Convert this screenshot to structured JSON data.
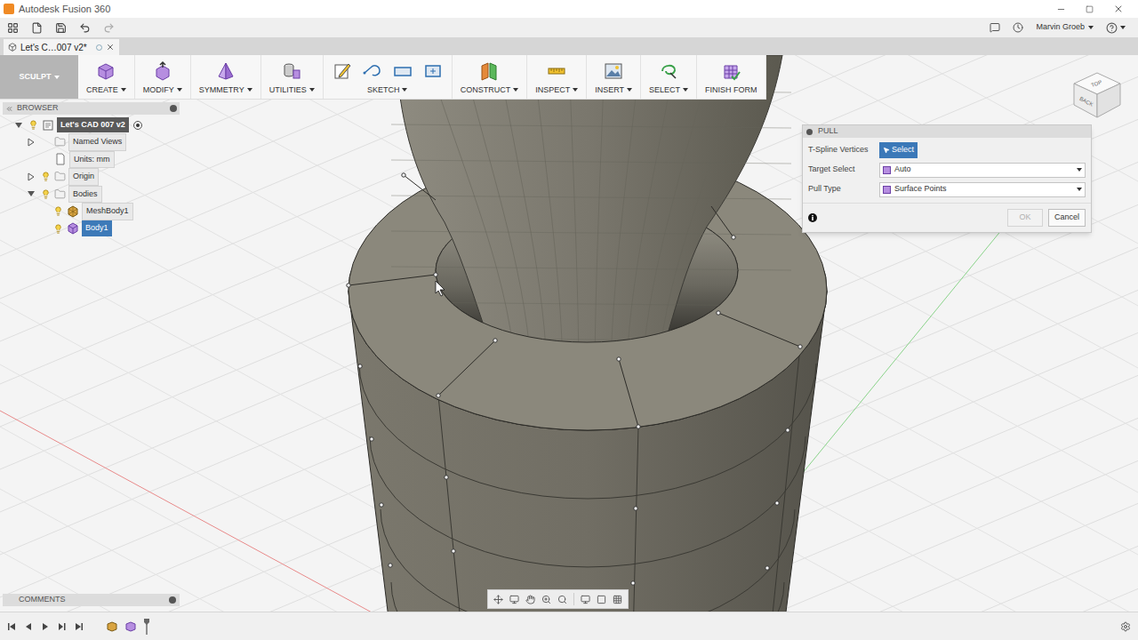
{
  "window": {
    "title": "Autodesk Fusion 360"
  },
  "user": "Marvin Groeb",
  "document_tab": {
    "label": "Let's C…007 v2*",
    "selected": true
  },
  "workspace": {
    "label": "SCULPT",
    "dropdown": true
  },
  "ribbon": [
    {
      "label": "CREATE",
      "dropdown": true,
      "icons": 1
    },
    {
      "label": "MODIFY",
      "dropdown": true,
      "icons": 1
    },
    {
      "label": "SYMMETRY",
      "dropdown": true,
      "icons": 1
    },
    {
      "label": "UTILITIES",
      "dropdown": true,
      "icons": 1
    },
    {
      "label": "SKETCH",
      "dropdown": true,
      "icons": 4
    },
    {
      "label": "CONSTRUCT",
      "dropdown": true,
      "icons": 1
    },
    {
      "label": "INSPECT",
      "dropdown": true,
      "icons": 1
    },
    {
      "label": "INSERT",
      "dropdown": true,
      "icons": 1
    },
    {
      "label": "SELECT",
      "dropdown": true,
      "icons": 1
    },
    {
      "label": "FINISH FORM",
      "dropdown": false,
      "icons": 1
    }
  ],
  "browser": {
    "title": "BROWSER",
    "items": [
      {
        "label": "Let's CAD 007 v2",
        "depth": 0,
        "kind": "root",
        "expandable": true,
        "expanded": true,
        "visible": true,
        "selected": true
      },
      {
        "label": "Named Views",
        "depth": 1,
        "kind": "folder",
        "expandable": true,
        "expanded": false,
        "visible": false,
        "selected": false
      },
      {
        "label": "Units: mm",
        "depth": 1,
        "kind": "units",
        "expandable": false,
        "expanded": false,
        "visible": false,
        "selected": false
      },
      {
        "label": "Origin",
        "depth": 1,
        "kind": "folder",
        "expandable": true,
        "expanded": false,
        "visible": true,
        "selected": false
      },
      {
        "label": "Bodies",
        "depth": 1,
        "kind": "folder",
        "expandable": true,
        "expanded": true,
        "visible": true,
        "selected": false
      },
      {
        "label": "MeshBody1",
        "depth": 2,
        "kind": "mesh",
        "expandable": false,
        "expanded": false,
        "visible": true,
        "selected": false
      },
      {
        "label": "Body1",
        "depth": 2,
        "kind": "body",
        "expandable": false,
        "expanded": false,
        "visible": true,
        "selected": true
      }
    ]
  },
  "pull_dialog": {
    "title": "PULL",
    "fields": [
      {
        "label": "T-Spline Vertices",
        "kind": "button",
        "value": "Select",
        "selected": true
      },
      {
        "label": "Target Select",
        "kind": "dropdown",
        "value": "Auto",
        "selected": false
      },
      {
        "label": "Pull Type",
        "kind": "dropdown",
        "value": "Surface Points",
        "selected": false
      }
    ],
    "buttons": [
      {
        "label": "OK",
        "disabled": true
      },
      {
        "label": "Cancel",
        "disabled": false
      }
    ]
  },
  "comments": {
    "title": "COMMENTS"
  },
  "view_cube": {
    "faces": [
      "TOP",
      "BACK"
    ]
  }
}
